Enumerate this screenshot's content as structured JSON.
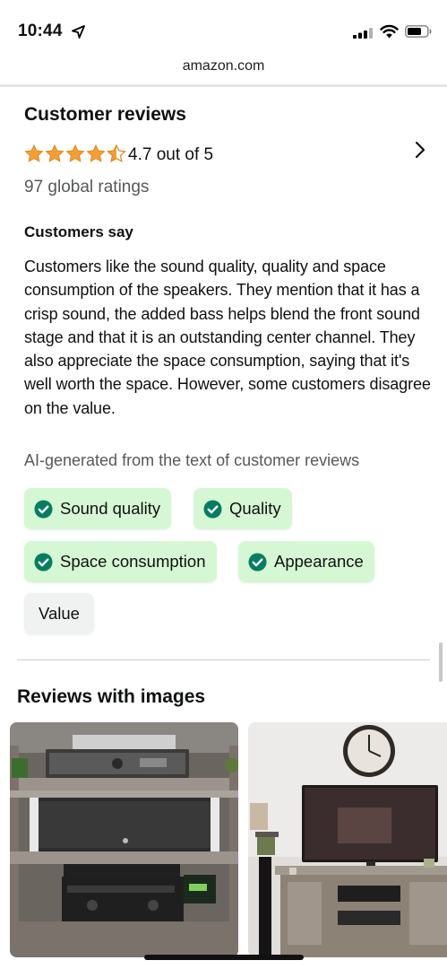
{
  "status": {
    "time": "10:44"
  },
  "browser": {
    "url": "amazon.com"
  },
  "reviews": {
    "title": "Customer reviews",
    "rating_text": "4.7 out of 5",
    "rating_value": 4.7,
    "global_ratings": "97 global ratings",
    "customers_say_title": "Customers say",
    "summary": "Customers like the sound quality, quality and space consumption of the speakers. They mention that it has a crisp sound, the added bass helps blend the front sound stage and that it is an outstanding center channel. They also appreciate the space consumption, saying that it's well worth the space. However, some customers disagree on the value.",
    "ai_note": "AI-generated from the text of customer reviews",
    "aspects": [
      {
        "label": "Sound quality",
        "sentiment": "positive"
      },
      {
        "label": "Quality",
        "sentiment": "positive"
      },
      {
        "label": "Space consumption",
        "sentiment": "positive"
      },
      {
        "label": "Appearance",
        "sentiment": "positive"
      },
      {
        "label": "Value",
        "sentiment": "neutral"
      }
    ]
  },
  "images_section": {
    "title": "Reviews with images"
  },
  "colors": {
    "star": "#f59f33",
    "positive_chip": "#d6f7d4",
    "check": "#067d62",
    "neutral_chip": "#f0f2f2"
  },
  "icons": [
    "location-arrow-icon",
    "signal-icon",
    "wifi-icon",
    "battery-icon",
    "star-icon",
    "chevron-right-icon",
    "check-circle-icon"
  ]
}
